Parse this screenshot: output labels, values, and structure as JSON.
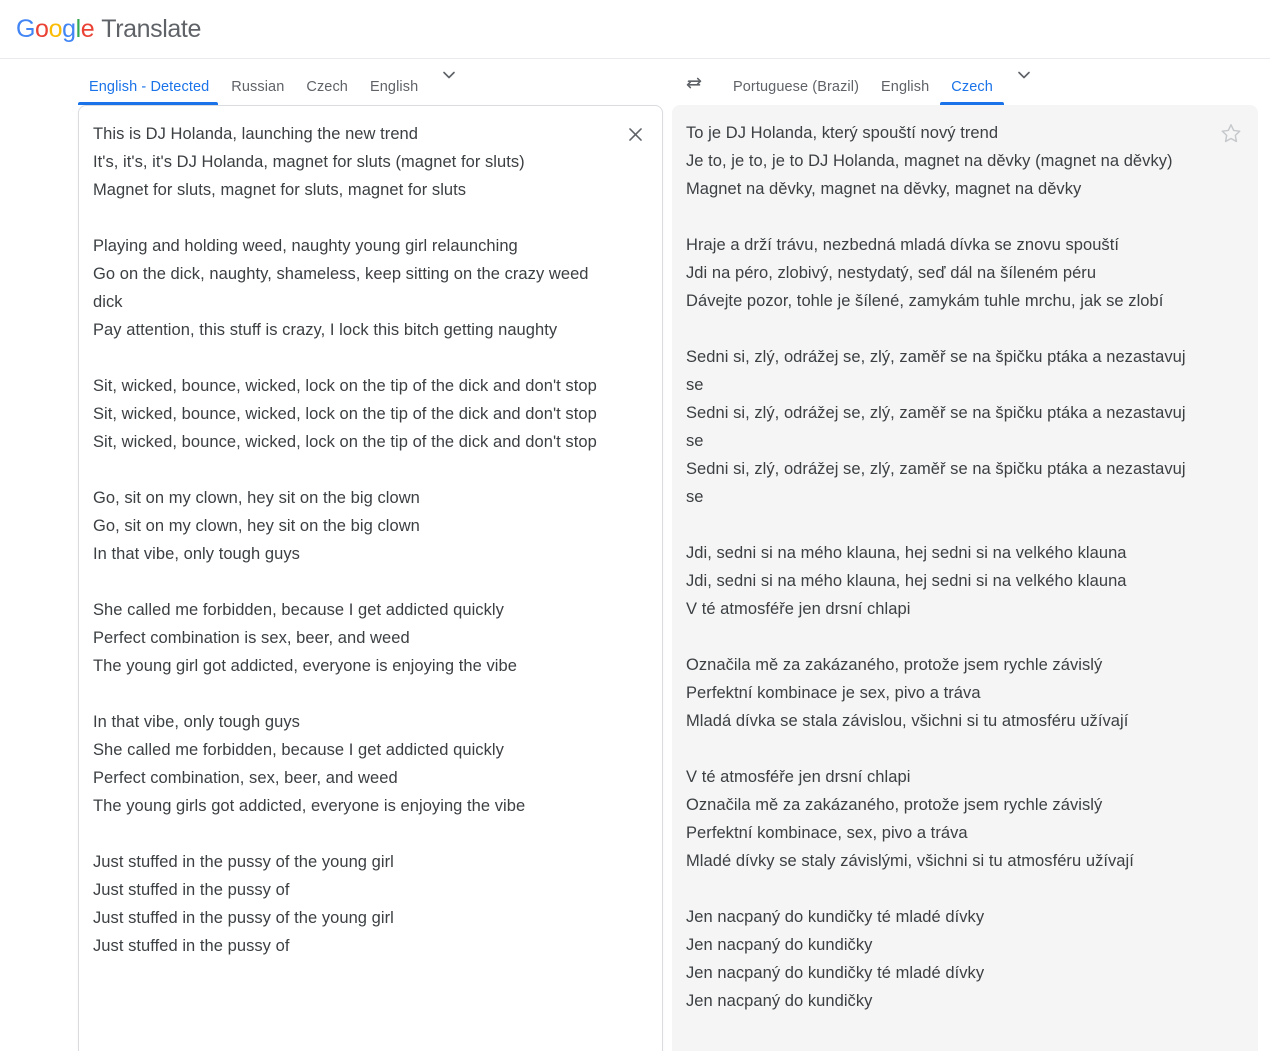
{
  "header": {
    "brand_letters": [
      "G",
      "o",
      "o",
      "g",
      "l",
      "e"
    ],
    "product": "Translate",
    "logo_colors": {
      "blue": "#4285F4",
      "red": "#EA4335",
      "yellow": "#FBBC05",
      "green": "#34A853",
      "product_gray": "#5f6368"
    }
  },
  "accent_color": "#1a73e8",
  "source": {
    "tabs": [
      {
        "label": "English - Detected",
        "active": true
      },
      {
        "label": "Russian",
        "active": false
      },
      {
        "label": "Czech",
        "active": false
      },
      {
        "label": "English",
        "active": false
      }
    ],
    "more_languages_icon": "chevron-down-icon",
    "clear_icon": "close-icon",
    "text": "This is DJ Holanda, launching the new trend\nIt's, it's, it's DJ Holanda, magnet for sluts (magnet for sluts)\nMagnet for sluts, magnet for sluts, magnet for sluts\n\nPlaying and holding weed, naughty young girl relaunching\nGo on the dick, naughty, shameless, keep sitting on the crazy weed dick\nPay attention, this stuff is crazy, I lock this bitch getting naughty\n\nSit, wicked, bounce, wicked, lock on the tip of the dick and don't stop\nSit, wicked, bounce, wicked, lock on the tip of the dick and don't stop\nSit, wicked, bounce, wicked, lock on the tip of the dick and don't stop\n\nGo, sit on my clown, hey sit on the big clown\nGo, sit on my clown, hey sit on the big clown\nIn that vibe, only tough guys\n\nShe called me forbidden, because I get addicted quickly\nPerfect combination is sex, beer, and weed\nThe young girl got addicted, everyone is enjoying the vibe\n\nIn that vibe, only tough guys\nShe called me forbidden, because I get addicted quickly\nPerfect combination, sex, beer, and weed\nThe young girls got addicted, everyone is enjoying the vibe\n\nJust stuffed in the pussy of the young girl\nJust stuffed in the pussy of\nJust stuffed in the pussy of the young girl\nJust stuffed in the pussy of"
  },
  "target": {
    "swap_icon": "swap-languages-icon",
    "tabs": [
      {
        "label": "Portuguese (Brazil)",
        "active": false
      },
      {
        "label": "English",
        "active": false
      },
      {
        "label": "Czech",
        "active": true
      }
    ],
    "more_languages_icon": "chevron-down-icon",
    "save_icon": "star-outline-icon",
    "text": "To je DJ Holanda, který spouští nový trend\nJe to, je to, je to DJ Holanda, magnet na děvky (magnet na děvky)\nMagnet na děvky, magnet na děvky, magnet na děvky\n\nHraje a drží trávu, nezbedná mladá dívka se znovu spouští\nJdi na péro, zlobivý, nestydatý, seď dál na šíleném péru\nDávejte pozor, tohle je šílené, zamykám tuhle mrchu, jak se zlobí\n\nSedni si, zlý, odrážej se, zlý, zaměř se na špičku ptáka a nezastavuj se\nSedni si, zlý, odrážej se, zlý, zaměř se na špičku ptáka a nezastavuj se\nSedni si, zlý, odrážej se, zlý, zaměř se na špičku ptáka a nezastavuj se\n\nJdi, sedni si na mého klauna, hej sedni si na velkého klauna\nJdi, sedni si na mého klauna, hej sedni si na velkého klauna\nV té atmosféře jen drsní chlapi\n\nOznačila mě za zakázaného, protože jsem rychle závislý\nPerfektní kombinace je sex, pivo a tráva\nMladá dívka se stala závislou, všichni si tu atmosféru užívají\n\nV té atmosféře jen drsní chlapi\nOznačila mě za zakázaného, protože jsem rychle závislý\nPerfektní kombinace, sex, pivo a tráva\nMladé dívky se staly závislými, všichni si tu atmosféru užívají\n\nJen nacpaný do kundičky té mladé dívky\nJen nacpaný do kundičky\nJen nacpaný do kundičky té mladé dívky\nJen nacpaný do kundičky"
  }
}
